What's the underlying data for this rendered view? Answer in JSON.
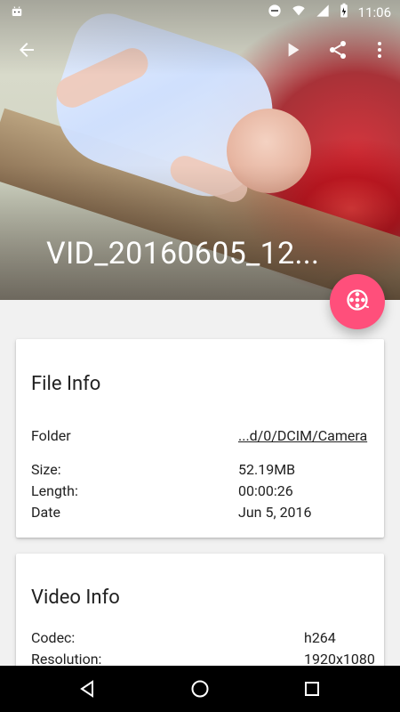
{
  "status_bar": {
    "time": "11:06",
    "icons": [
      "android-icon",
      "do-not-disturb-icon",
      "wifi-icon",
      "signal-icon",
      "battery-charging-icon"
    ]
  },
  "toolbar": {
    "back": "back-arrow-icon",
    "play": "play-icon",
    "share": "share-icon",
    "more": "more-vert-icon"
  },
  "header": {
    "title": "VID_20160605_12..."
  },
  "fab": {
    "icon": "film-reel-icon",
    "color": "#ff4f7b"
  },
  "file_info": {
    "title": "File Info",
    "rows": [
      {
        "label": "Folder",
        "value": "...d/0/DCIM/Camera"
      },
      {
        "label": "Size:",
        "value": "52.19MB"
      },
      {
        "label": "Length:",
        "value": "00:00:26"
      },
      {
        "label": "Date",
        "value": "Jun 5, 2016"
      }
    ]
  },
  "video_info": {
    "title": "Video Info",
    "rows": [
      {
        "label": "Codec:",
        "value": "h264"
      },
      {
        "label": "Resolution:",
        "value": "1920x1080"
      }
    ]
  },
  "nav_bar": {
    "back": "nav-back-icon",
    "home": "nav-home-icon",
    "recent": "nav-recents-icon"
  }
}
